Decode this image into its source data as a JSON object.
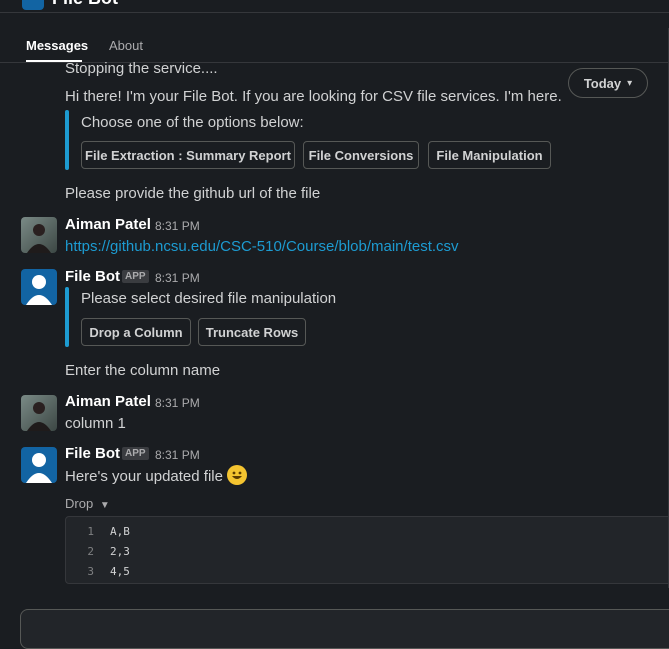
{
  "app": {
    "title": "File Bot"
  },
  "tabs": [
    {
      "label": "Messages"
    },
    {
      "label": "About"
    }
  ],
  "date_divider": {
    "label": "Today"
  },
  "messages": {
    "m0": {
      "text": "Stopping the service...."
    },
    "m1": {
      "text": "Hi there! I'm your File Bot. If you are looking for CSV file services. I'm here.",
      "attachment_text": "Choose one of the options below:",
      "buttons": [
        "File Extraction : Summary Report",
        "File Conversions",
        "File Manipulation"
      ]
    },
    "m2": {
      "text": "Please provide the github url of the file"
    },
    "m3": {
      "sender": "Aiman Patel",
      "time": "8:31 PM",
      "link": "https://github.ncsu.edu/CSC-510/Course/blob/main/test.csv"
    },
    "m4": {
      "sender": "File Bot",
      "badge": "APP",
      "time": "8:31 PM",
      "attachment_text": "Please select desired file manipulation",
      "buttons": [
        "Drop a Column",
        "Truncate Rows"
      ]
    },
    "m5": {
      "text": "Enter the column name"
    },
    "m6": {
      "sender": "Aiman Patel",
      "time": "8:31 PM",
      "text": "column 1"
    },
    "m7": {
      "sender": "File Bot",
      "badge": "APP",
      "time": "8:31 PM",
      "text": "Here's your updated file",
      "file_name": "Drop",
      "code_lines": [
        {
          "num": "1",
          "content": "A,B"
        },
        {
          "num": "2",
          "content": "2,3"
        },
        {
          "num": "3",
          "content": "4,5"
        }
      ]
    }
  },
  "icons": {
    "chevron": "chevron-down-icon",
    "emoji": "grinning-face-emoji"
  },
  "colors": {
    "background": "#1a1d21",
    "link": "#1d9bd1",
    "attachment_bar": "#1d9bd1",
    "bot_avatar": "#1264a3"
  }
}
